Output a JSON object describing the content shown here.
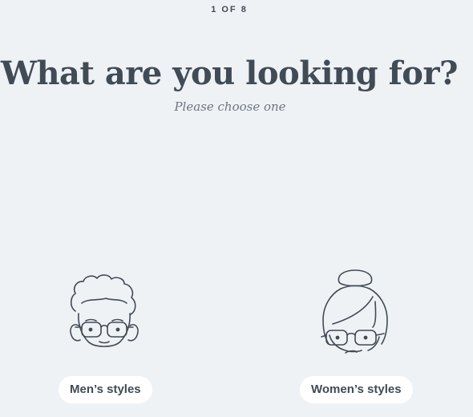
{
  "header": {
    "step_indicator": "1 OF 8"
  },
  "question": {
    "title": "What are you looking for?",
    "subtitle": "Please choose one"
  },
  "options": [
    {
      "label": "Men’s styles",
      "icon": "man-with-glasses-icon"
    },
    {
      "label": "Women’s styles",
      "icon": "woman-with-glasses-icon"
    }
  ],
  "colors": {
    "background": "#eff2f5",
    "text": "#414b56",
    "pill_background": "#ffffff"
  }
}
